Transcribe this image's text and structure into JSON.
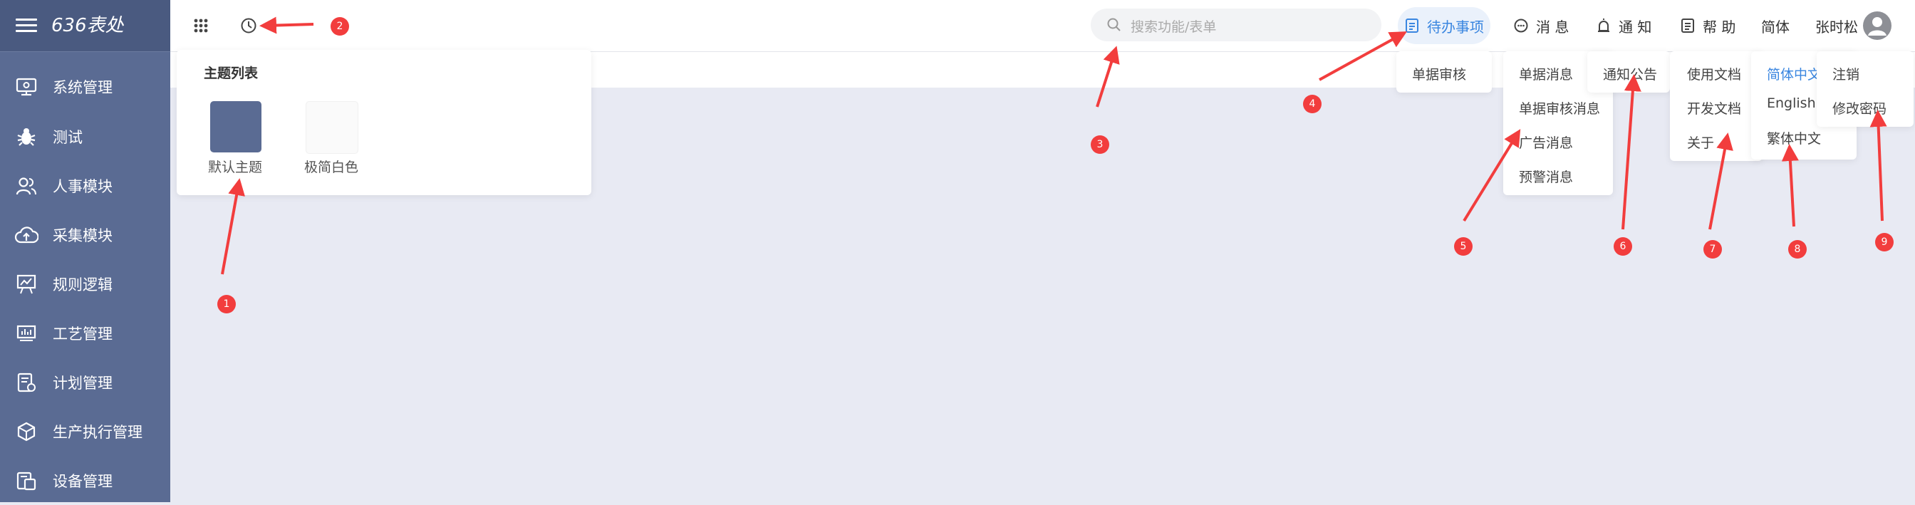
{
  "app": {
    "title": "636表处"
  },
  "sidebar": {
    "items": [
      {
        "label": "系统管理",
        "icon": "monitor-settings-icon"
      },
      {
        "label": "测试",
        "icon": "bug-icon"
      },
      {
        "label": "人事模块",
        "icon": "users-icon"
      },
      {
        "label": "采集模块",
        "icon": "cloud-upload-icon"
      },
      {
        "label": "规则逻辑",
        "icon": "presentation-icon"
      },
      {
        "label": "工艺管理",
        "icon": "chart-board-icon"
      },
      {
        "label": "计划管理",
        "icon": "doc-settings-icon"
      },
      {
        "label": "生产执行管理",
        "icon": "cube-icon"
      },
      {
        "label": "设备管理",
        "icon": "device-icon"
      }
    ]
  },
  "header": {
    "search_placeholder": "搜索功能/表单",
    "todo_label": "待办事项",
    "message_label": "消 息",
    "notice_label": "通 知",
    "help_label": "帮 助",
    "lang_label": "简体",
    "user_name": "张时松"
  },
  "theme_panel": {
    "title": "主题列表",
    "themes": [
      {
        "label": "默认主题",
        "color": "#5a6b93"
      },
      {
        "label": "极简白色",
        "color": "#fafafa"
      }
    ]
  },
  "dropdowns": {
    "todo": [
      "单据审核"
    ],
    "message": [
      "单据消息",
      "单据审核消息",
      "广告消息",
      "预警消息"
    ],
    "notice": [
      "通知公告"
    ],
    "help": [
      "使用文档",
      "开发文档",
      "关于"
    ],
    "language": [
      "简体中文",
      "English",
      "繁体中文"
    ],
    "user": [
      "注销",
      "修改密码"
    ]
  },
  "annotations": [
    "1",
    "2",
    "3",
    "4",
    "5",
    "6",
    "7",
    "8",
    "9"
  ],
  "colors": {
    "sidebar": "#5a6b93",
    "accent": "#3a86e0",
    "marker": "#f23d3d",
    "background": "#e8eaf3"
  }
}
